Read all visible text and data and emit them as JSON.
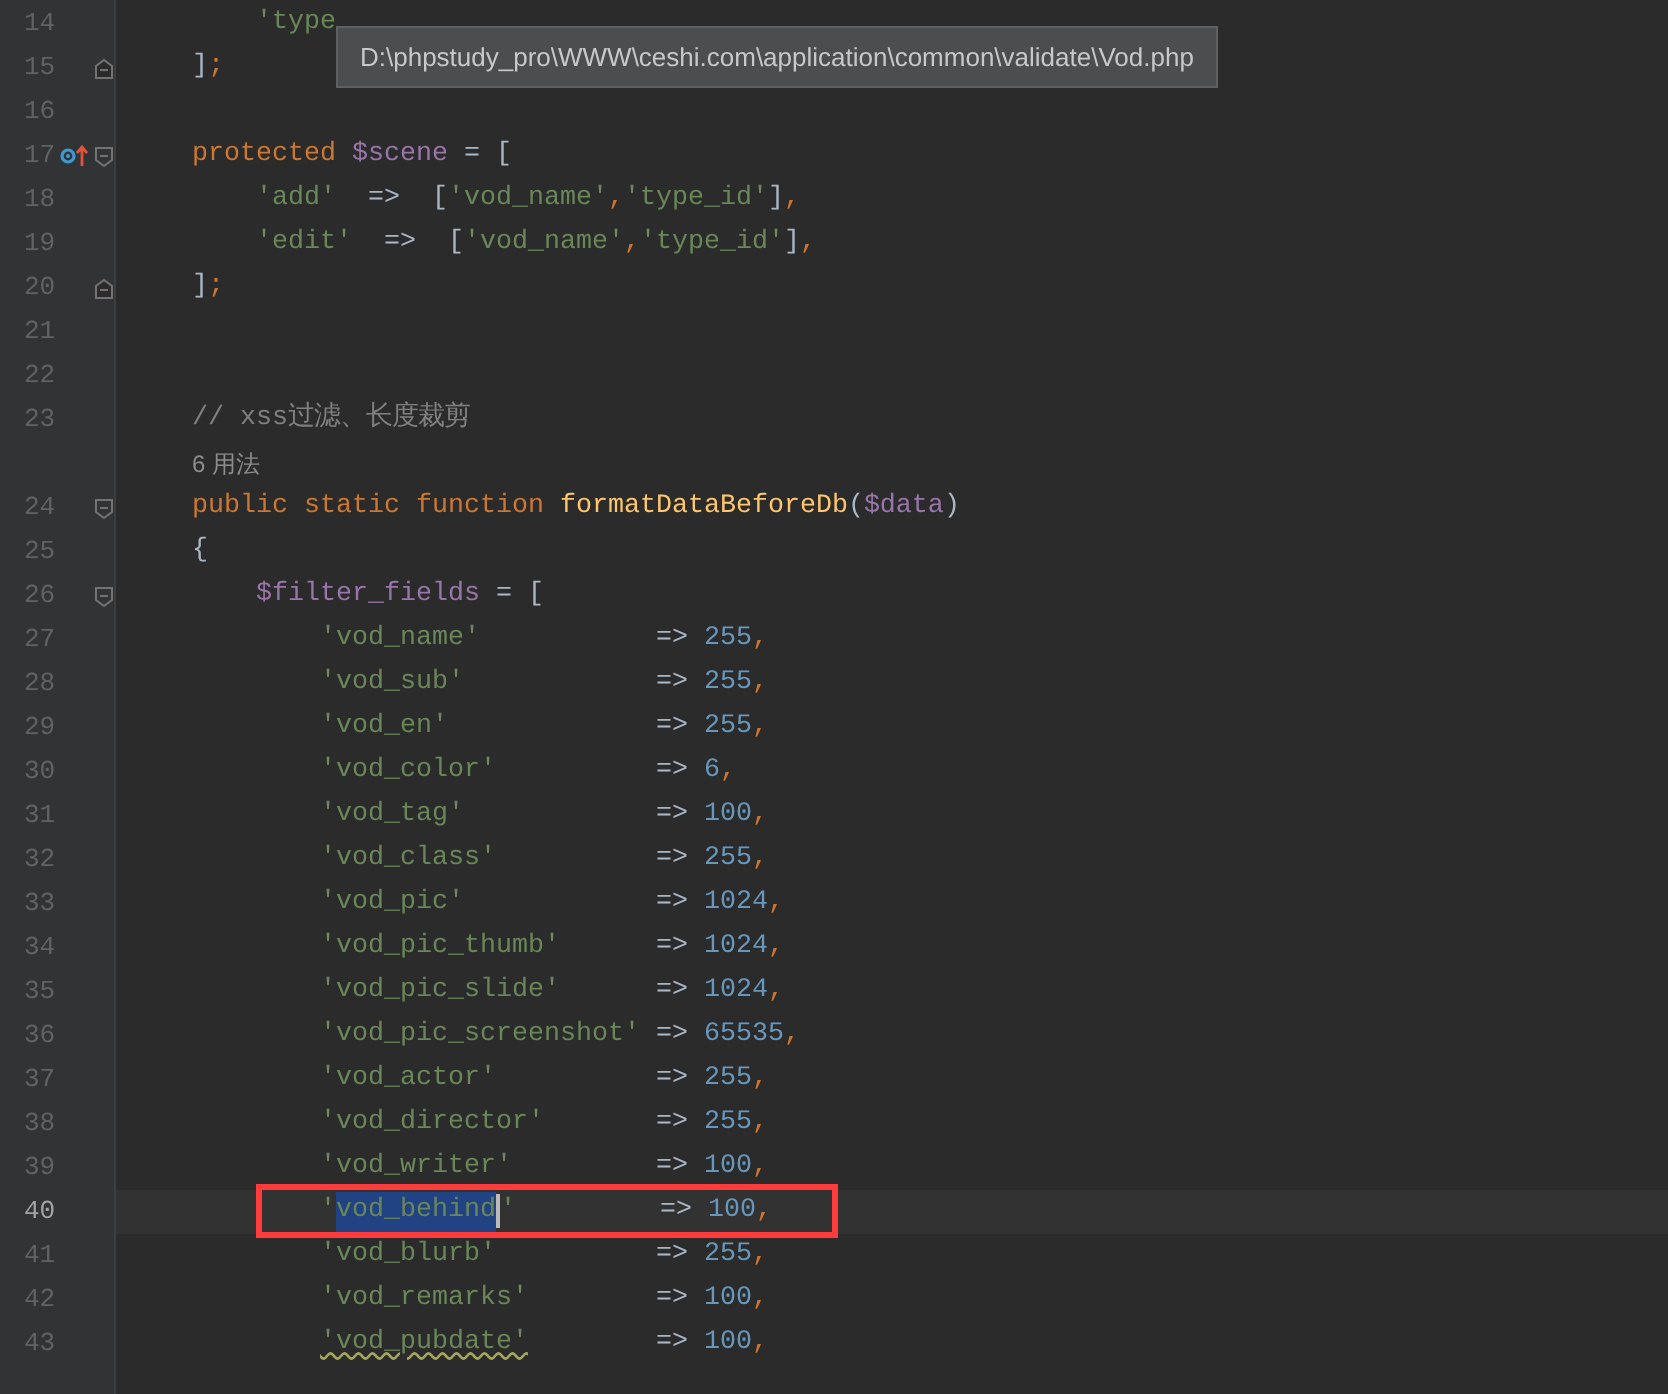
{
  "editor": {
    "lines": [
      {
        "number": "14",
        "current": false,
        "segments": [
          {
            "kind": "string",
            "text": "        'type"
          }
        ]
      },
      {
        "number": "15",
        "current": false,
        "fold": {
          "kind": "end"
        },
        "segments": [
          {
            "kind": "punct",
            "text": "    ]"
          },
          {
            "kind": "comma",
            "text": ";"
          }
        ]
      },
      {
        "number": "16",
        "current": false
      },
      {
        "number": "17",
        "current": false,
        "fold": {
          "kind": "start"
        },
        "marker": {
          "kind": "override"
        },
        "segments": [
          {
            "kind": "keyword",
            "text": "    protected "
          },
          {
            "kind": "variable",
            "text": "$scene"
          },
          {
            "kind": "punct",
            "text": " = ["
          }
        ]
      },
      {
        "number": "18",
        "current": false,
        "segments": [
          {
            "kind": "string",
            "text": "        'add'"
          },
          {
            "kind": "punct",
            "text": "  =>  ["
          },
          {
            "kind": "string",
            "text": "'vod_name'"
          },
          {
            "kind": "comma",
            "text": ","
          },
          {
            "kind": "string",
            "text": "'type_id'"
          },
          {
            "kind": "punct",
            "text": "]"
          },
          {
            "kind": "comma",
            "text": ","
          }
        ]
      },
      {
        "number": "19",
        "current": false,
        "segments": [
          {
            "kind": "string",
            "text": "        'edit'"
          },
          {
            "kind": "punct",
            "text": "  =>  ["
          },
          {
            "kind": "string",
            "text": "'vod_name'"
          },
          {
            "kind": "comma",
            "text": ","
          },
          {
            "kind": "string",
            "text": "'type_id'"
          },
          {
            "kind": "punct",
            "text": "]"
          },
          {
            "kind": "comma",
            "text": ","
          }
        ]
      },
      {
        "number": "20",
        "current": false,
        "fold": {
          "kind": "end"
        },
        "segments": [
          {
            "kind": "punct",
            "text": "    ]"
          },
          {
            "kind": "comma",
            "text": ";"
          }
        ]
      },
      {
        "number": "21",
        "current": false
      },
      {
        "number": "22",
        "current": false
      },
      {
        "number": "23",
        "current": false,
        "segments": [
          {
            "kind": "comment",
            "text": "    // xss过滤、长度裁剪"
          }
        ]
      },
      {
        "kind": "inlay",
        "text": "    6 用法"
      },
      {
        "number": "24",
        "current": false,
        "fold": {
          "kind": "start"
        },
        "segments": [
          {
            "kind": "keyword",
            "text": "    public static function "
          },
          {
            "kind": "function",
            "text": "formatDataBeforeDb"
          },
          {
            "kind": "punct",
            "text": "("
          },
          {
            "kind": "variable",
            "text": "$data"
          },
          {
            "kind": "punct",
            "text": ")"
          }
        ]
      },
      {
        "number": "25",
        "current": false,
        "segments": [
          {
            "kind": "punct",
            "text": "    {"
          }
        ]
      },
      {
        "number": "26",
        "current": false,
        "fold": {
          "kind": "start"
        },
        "segments": [
          {
            "kind": "variable",
            "text": "        $filter_fields"
          },
          {
            "kind": "punct",
            "text": " = ["
          }
        ]
      },
      {
        "number": "27",
        "current": false,
        "segments": [
          {
            "kind": "string",
            "text": "            'vod_name'"
          },
          {
            "kind": "punct",
            "text": "           => "
          },
          {
            "kind": "number",
            "text": "255"
          },
          {
            "kind": "comma",
            "text": ","
          }
        ]
      },
      {
        "number": "28",
        "current": false,
        "segments": [
          {
            "kind": "string",
            "text": "            'vod_sub'"
          },
          {
            "kind": "punct",
            "text": "            => "
          },
          {
            "kind": "number",
            "text": "255"
          },
          {
            "kind": "comma",
            "text": ","
          }
        ]
      },
      {
        "number": "29",
        "current": false,
        "segments": [
          {
            "kind": "string",
            "text": "            'vod_en'"
          },
          {
            "kind": "punct",
            "text": "             => "
          },
          {
            "kind": "number",
            "text": "255"
          },
          {
            "kind": "comma",
            "text": ","
          }
        ]
      },
      {
        "number": "30",
        "current": false,
        "segments": [
          {
            "kind": "string",
            "text": "            'vod_color'"
          },
          {
            "kind": "punct",
            "text": "          => "
          },
          {
            "kind": "number",
            "text": "6"
          },
          {
            "kind": "comma",
            "text": ","
          }
        ]
      },
      {
        "number": "31",
        "current": false,
        "segments": [
          {
            "kind": "string",
            "text": "            'vod_tag'"
          },
          {
            "kind": "punct",
            "text": "            => "
          },
          {
            "kind": "number",
            "text": "100"
          },
          {
            "kind": "comma",
            "text": ","
          }
        ]
      },
      {
        "number": "32",
        "current": false,
        "segments": [
          {
            "kind": "string",
            "text": "            'vod_class'"
          },
          {
            "kind": "punct",
            "text": "          => "
          },
          {
            "kind": "number",
            "text": "255"
          },
          {
            "kind": "comma",
            "text": ","
          }
        ]
      },
      {
        "number": "33",
        "current": false,
        "segments": [
          {
            "kind": "string",
            "text": "            'vod_pic'"
          },
          {
            "kind": "punct",
            "text": "            => "
          },
          {
            "kind": "number",
            "text": "1024"
          },
          {
            "kind": "comma",
            "text": ","
          }
        ]
      },
      {
        "number": "34",
        "current": false,
        "segments": [
          {
            "kind": "string",
            "text": "            'vod_pic_thumb'"
          },
          {
            "kind": "punct",
            "text": "      => "
          },
          {
            "kind": "number",
            "text": "1024"
          },
          {
            "kind": "comma",
            "text": ","
          }
        ]
      },
      {
        "number": "35",
        "current": false,
        "segments": [
          {
            "kind": "string",
            "text": "            'vod_pic_slide'"
          },
          {
            "kind": "punct",
            "text": "      => "
          },
          {
            "kind": "number",
            "text": "1024"
          },
          {
            "kind": "comma",
            "text": ","
          }
        ]
      },
      {
        "number": "36",
        "current": false,
        "segments": [
          {
            "kind": "string",
            "text": "            'vod_pic_screenshot'"
          },
          {
            "kind": "punct",
            "text": " => "
          },
          {
            "kind": "number",
            "text": "65535"
          },
          {
            "kind": "comma",
            "text": ","
          }
        ]
      },
      {
        "number": "37",
        "current": false,
        "segments": [
          {
            "kind": "string",
            "text": "            'vod_actor'"
          },
          {
            "kind": "punct",
            "text": "          => "
          },
          {
            "kind": "number",
            "text": "255"
          },
          {
            "kind": "comma",
            "text": ","
          }
        ]
      },
      {
        "number": "38",
        "current": false,
        "segments": [
          {
            "kind": "string",
            "text": "            'vod_director'"
          },
          {
            "kind": "punct",
            "text": "       => "
          },
          {
            "kind": "number",
            "text": "255"
          },
          {
            "kind": "comma",
            "text": ","
          }
        ]
      },
      {
        "number": "39",
        "current": false,
        "segments": [
          {
            "kind": "string",
            "text": "            'vod_writer'"
          },
          {
            "kind": "punct",
            "text": "         => "
          },
          {
            "kind": "number",
            "text": "100"
          },
          {
            "kind": "comma",
            "text": ","
          }
        ]
      },
      {
        "number": "40",
        "current": true,
        "annotation": {
          "kind": "frame"
        },
        "segments": [
          {
            "kind": "string",
            "text": "            '"
          },
          {
            "kind": "selection",
            "text": "vod_behind"
          },
          {
            "kind": "string",
            "text": "'"
          },
          {
            "kind": "punct",
            "text": "         => "
          },
          {
            "kind": "number",
            "text": "100"
          },
          {
            "kind": "comma",
            "text": ","
          }
        ]
      },
      {
        "number": "41",
        "current": false,
        "segments": [
          {
            "kind": "string",
            "text": "            'vod_blurb'"
          },
          {
            "kind": "punct",
            "text": "          => "
          },
          {
            "kind": "number",
            "text": "255"
          },
          {
            "kind": "comma",
            "text": ","
          }
        ]
      },
      {
        "number": "42",
        "current": false,
        "segments": [
          {
            "kind": "string",
            "text": "            'vod_remarks'"
          },
          {
            "kind": "punct",
            "text": "        => "
          },
          {
            "kind": "number",
            "text": "100"
          },
          {
            "kind": "comma",
            "text": ","
          }
        ]
      },
      {
        "number": "43",
        "current": false,
        "segments": [
          {
            "kind": "string_typo",
            "text": "            'vod_pubdate'"
          },
          {
            "kind": "punct",
            "text": "        => "
          },
          {
            "kind": "number",
            "text": "100"
          },
          {
            "kind": "comma",
            "text": ","
          }
        ]
      }
    ]
  },
  "tooltip": {
    "text": "D:\\phpstudy_pro\\WWW\\ceshi.com\\application\\common\\validate\\Vod.php"
  }
}
